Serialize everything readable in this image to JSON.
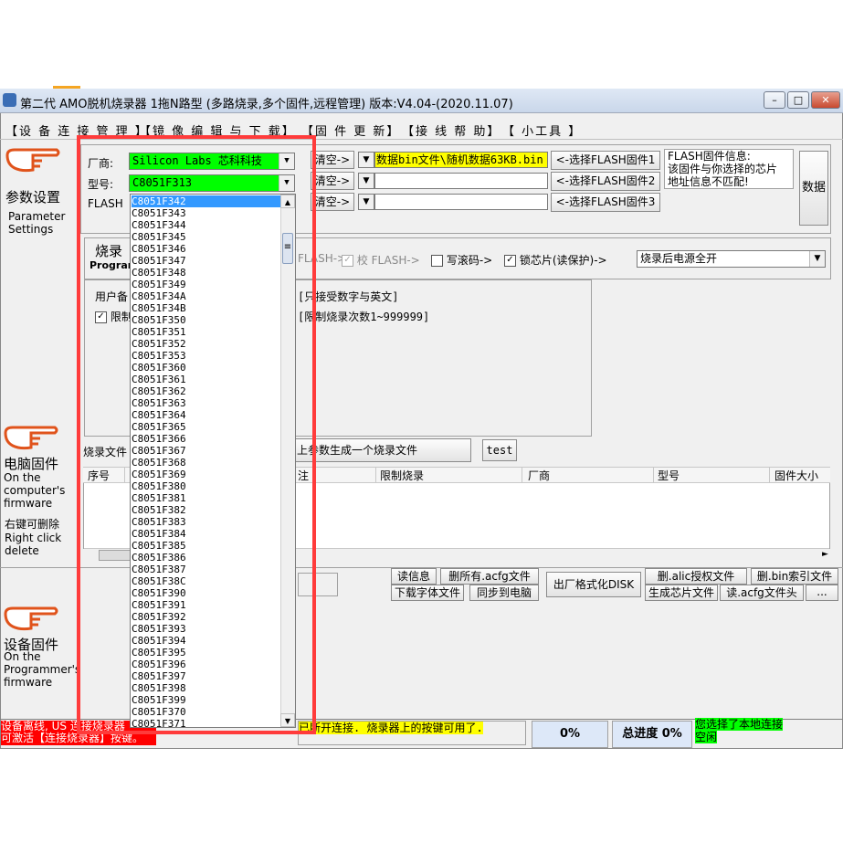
{
  "window": {
    "title": "第二代 AMO脱机烧录器 1拖N路型 (多路烧录,多个固件,远程管理)  版本:V4.04-(2020.11.07)",
    "min": "–",
    "max": "□",
    "close": "✕"
  },
  "menu": [
    "【设 备 连 接 管 理 】",
    "【镜 像 编 辑 与 下 载】",
    "【固 件 更 新】",
    "【接 线 帮 助】",
    "【 小工具 】"
  ],
  "sidebar": {
    "param_cn": "参数设置",
    "param_en": "Parameter\nSettings",
    "pc_cn": "电脑固件",
    "pc_en": "On the\ncomputer's\nfirmware",
    "rc_cn": "右键可删除",
    "rc_en": "Right click\ndelete",
    "dev_cn": "设备固件",
    "dev_en": "On the\nProgrammer's\nfirmware"
  },
  "form": {
    "vendor_label": "厂商:",
    "vendor_value": "Silicon Labs     芯科科技",
    "model_label": "型号:",
    "model_value": "C8051F313",
    "flash_label": "FLASH",
    "clear_labels": [
      "清空->",
      "清空->",
      "清空->"
    ],
    "file1": "数据bin文件\\随机数据63KB.bin",
    "select_fw": [
      "<-选择FLASH固件1",
      "<-选择FLASH固件2",
      "<-选择FLASH固件3"
    ],
    "fw_info": "FLASH固件信息:\n该固件与你选择的芯片\n地址信息不匹配!",
    "data_btn": "数据"
  },
  "burn": {
    "title_cn": "烧录",
    "title_en": "Program",
    "opt1": "FLASH->",
    "opt_verify": "校 FLASH->",
    "opt_serial": "写滚码->",
    "opt_lock": "锁芯片(读保护)->",
    "power_option": "烧录后电源全开",
    "user_label": "用户备",
    "limit_label": "限制",
    "hint1": "[只接受数字与英文]",
    "hint2": "[限制烧录次数1~999999]"
  },
  "file_row": {
    "label": "烧录文件",
    "generate": "上参数生成一个烧录文件",
    "test": "test"
  },
  "table": {
    "headers": [
      "序号",
      "注",
      "限制烧录",
      "厂商",
      "型号",
      "固件大小"
    ]
  },
  "actions": {
    "read_info": "读信息",
    "delete_all": "删所有.acfg文件",
    "download_font": "下载字体文件",
    "sync_pc": "同步到电脑",
    "format_disk": "出厂格式化DISK",
    "delete_alic": "删.alic授权文件",
    "delete_bin": "删.bin索引文件",
    "gen_chip": "生成芯片文件",
    "read_acfg": "读.acfg文件头",
    "more": "..."
  },
  "status": {
    "left": "设备离线, US 连接烧录器\n可激活【连接烧录器】按键。",
    "mid": "已断开连接. 烧录器上的按键可用了.",
    "pct": "0%",
    "total": "总进度 0%",
    "local": "您选择了本地连接",
    "idle": "空闲"
  },
  "dropdown": {
    "items": [
      "C8051F342",
      "C8051F343",
      "C8051F344",
      "C8051F345",
      "C8051F346",
      "C8051F347",
      "C8051F348",
      "C8051F349",
      "C8051F34A",
      "C8051F34B",
      "C8051F350",
      "C8051F351",
      "C8051F352",
      "C8051F353",
      "C8051F360",
      "C8051F361",
      "C8051F362",
      "C8051F363",
      "C8051F364",
      "C8051F365",
      "C8051F366",
      "C8051F367",
      "C8051F368",
      "C8051F369",
      "C8051F380",
      "C8051F381",
      "C8051F382",
      "C8051F383",
      "C8051F384",
      "C8051F385",
      "C8051F386",
      "C8051F387",
      "C8051F38C",
      "C8051F390",
      "C8051F391",
      "C8051F392",
      "C8051F393",
      "C8051F394",
      "C8051F395",
      "C8051F396",
      "C8051F397",
      "C8051F398",
      "C8051F399",
      "C8051F370",
      "C8051F371"
    ],
    "selected_index": 0
  },
  "colors": {
    "highlight": "#ff3b3b",
    "green": "#00ff00",
    "yellow": "#ffff00",
    "selection": "#3399ff",
    "red_status": "#ff0000"
  }
}
